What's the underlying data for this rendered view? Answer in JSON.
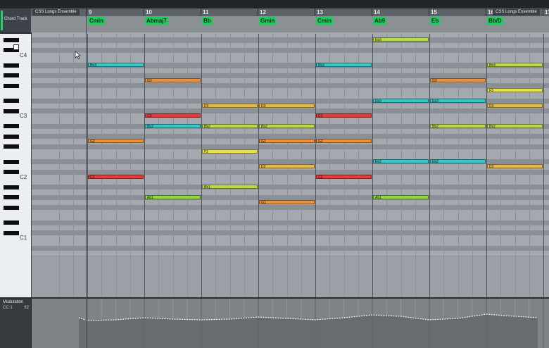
{
  "region": {
    "name": "CSS Longs Ensemble"
  },
  "chord_track": {
    "label": "Chord Track",
    "chords": [
      {
        "name": "Cmin",
        "bar": 9
      },
      {
        "name": "Abmaj7",
        "bar": 10
      },
      {
        "name": "Bb",
        "bar": 11
      },
      {
        "name": "Gmin",
        "bar": 12
      },
      {
        "name": "Cmin",
        "bar": 13
      },
      {
        "name": "Ab9",
        "bar": 14
      },
      {
        "name": "Eb",
        "bar": 15
      },
      {
        "name": "Bb/D",
        "bar": 16
      }
    ]
  },
  "ruler": {
    "bars": [
      "9",
      "10",
      "11",
      "12",
      "13",
      "14",
      "15",
      "16",
      "17"
    ]
  },
  "keyboard": {
    "labels": [
      "C4",
      "C3",
      "C2",
      "C1"
    ]
  },
  "notes": [
    {
      "pitch": "C2",
      "label": "C2",
      "start": 9,
      "len": 1,
      "color": "#e53b3b"
    },
    {
      "pitch": "G2",
      "label": "G2",
      "start": 9,
      "len": 1,
      "color": "#e9913b"
    },
    {
      "pitch": "Bb3",
      "label": "Bb3",
      "start": 9,
      "len": 1,
      "color": "#36c7c9"
    },
    {
      "pitch": "Ab1",
      "label": "Ab1",
      "start": 10,
      "len": 1,
      "color": "#8fd940"
    },
    {
      "pitch": "Bb2",
      "label": "Bb2",
      "start": 10,
      "len": 1,
      "color": "#36c7c9"
    },
    {
      "pitch": "C3",
      "label": "C3",
      "start": 10,
      "len": 1,
      "color": "#e53b3b"
    },
    {
      "pitch": "G3",
      "label": "G3",
      "start": 10,
      "len": 1,
      "color": "#e9913b"
    },
    {
      "pitch": "Bb1",
      "label": "Bb1",
      "start": 11,
      "len": 1,
      "color": "#b8d94a"
    },
    {
      "pitch": "F2",
      "label": "F2",
      "start": 11,
      "len": 1,
      "color": "#e8e04a"
    },
    {
      "pitch": "Bb2",
      "label": "Bb2",
      "start": 11,
      "len": 1,
      "color": "#b8d94a"
    },
    {
      "pitch": "D3",
      "label": "D3",
      "start": 11,
      "len": 1,
      "color": "#e8b845"
    },
    {
      "pitch": "G1",
      "label": "G1",
      "start": 12,
      "len": 1,
      "color": "#e9913b"
    },
    {
      "pitch": "D2",
      "label": "D2",
      "start": 12,
      "len": 1,
      "color": "#e8b845"
    },
    {
      "pitch": "G2",
      "label": "G2",
      "start": 12,
      "len": 1,
      "color": "#e9913b"
    },
    {
      "pitch": "Bb2",
      "label": "Bb2",
      "start": 12,
      "len": 1,
      "color": "#b8d94a"
    },
    {
      "pitch": "D3",
      "label": "D3",
      "start": 12,
      "len": 1,
      "color": "#e8b845"
    },
    {
      "pitch": "C2",
      "label": "C2",
      "start": 13,
      "len": 1,
      "color": "#e53b3b"
    },
    {
      "pitch": "G2",
      "label": "G2",
      "start": 13,
      "len": 1,
      "color": "#e9913b"
    },
    {
      "pitch": "C3",
      "label": "C3",
      "start": 13,
      "len": 1,
      "color": "#e53b3b"
    },
    {
      "pitch": "Bb3",
      "label": "Bb3",
      "start": 13,
      "len": 1,
      "color": "#36c7c9"
    },
    {
      "pitch": "Ab1",
      "label": "Ab1",
      "start": 14,
      "len": 1,
      "color": "#8fd940"
    },
    {
      "pitch": "Eb2",
      "label": "Eb2",
      "start": 14,
      "len": 1,
      "color": "#36c7c9"
    },
    {
      "pitch": "Eb3",
      "label": "Eb3",
      "start": 14,
      "len": 1,
      "color": "#36c7c9"
    },
    {
      "pitch": "Eb4",
      "label": "Eb3",
      "start": 14,
      "len": 1,
      "color": "#b8d94a"
    },
    {
      "pitch": "Eb2",
      "label": "Eb2",
      "start": 15,
      "len": 1,
      "color": "#36c7c9"
    },
    {
      "pitch": "Bb2",
      "label": "Bb2",
      "start": 15,
      "len": 1,
      "color": "#b8d94a"
    },
    {
      "pitch": "Eb3",
      "label": "Eb3",
      "start": 15,
      "len": 1,
      "color": "#36c7c9"
    },
    {
      "pitch": "G3",
      "label": "G3",
      "start": 15,
      "len": 1,
      "color": "#e9913b"
    },
    {
      "pitch": "D2",
      "label": "D2",
      "start": 16,
      "len": 1,
      "color": "#e8b845"
    },
    {
      "pitch": "Bb2",
      "label": "Bb2",
      "start": 16,
      "len": 1,
      "color": "#b8d94a"
    },
    {
      "pitch": "D3",
      "label": "D3",
      "start": 16,
      "len": 1,
      "color": "#e8b845"
    },
    {
      "pitch": "F3",
      "label": "F3",
      "start": 16,
      "len": 1,
      "color": "#e8e04a"
    },
    {
      "pitch": "Bb3",
      "label": "Bb3",
      "start": 16,
      "len": 1,
      "color": "#b8d94a"
    }
  ],
  "modulation": {
    "title": "Modulation",
    "cc": "CC 1",
    "value": "62",
    "curve": [
      [
        8.85,
        27
      ],
      [
        9,
        31
      ],
      [
        9.5,
        30
      ],
      [
        10,
        27
      ],
      [
        10.5,
        29
      ],
      [
        11,
        30
      ],
      [
        11.5,
        29
      ],
      [
        12,
        26
      ],
      [
        12.5,
        28
      ],
      [
        13,
        30
      ],
      [
        13.5,
        27
      ],
      [
        14,
        23
      ],
      [
        14.5,
        25
      ],
      [
        15,
        30
      ],
      [
        15.5,
        28
      ],
      [
        16,
        22
      ],
      [
        16.5,
        25
      ],
      [
        16.9,
        27
      ]
    ]
  }
}
